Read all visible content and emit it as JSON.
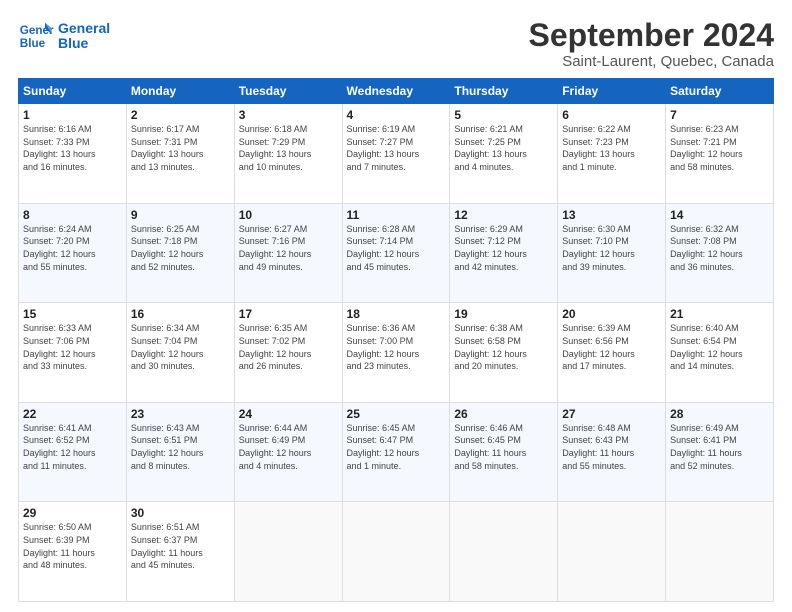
{
  "header": {
    "logo_line1": "General",
    "logo_line2": "Blue",
    "title": "September 2024",
    "subtitle": "Saint-Laurent, Quebec, Canada"
  },
  "calendar": {
    "days_of_week": [
      "Sunday",
      "Monday",
      "Tuesday",
      "Wednesday",
      "Thursday",
      "Friday",
      "Saturday"
    ],
    "weeks": [
      [
        {
          "day": "1",
          "info": "Sunrise: 6:16 AM\nSunset: 7:33 PM\nDaylight: 13 hours\nand 16 minutes."
        },
        {
          "day": "2",
          "info": "Sunrise: 6:17 AM\nSunset: 7:31 PM\nDaylight: 13 hours\nand 13 minutes."
        },
        {
          "day": "3",
          "info": "Sunrise: 6:18 AM\nSunset: 7:29 PM\nDaylight: 13 hours\nand 10 minutes."
        },
        {
          "day": "4",
          "info": "Sunrise: 6:19 AM\nSunset: 7:27 PM\nDaylight: 13 hours\nand 7 minutes."
        },
        {
          "day": "5",
          "info": "Sunrise: 6:21 AM\nSunset: 7:25 PM\nDaylight: 13 hours\nand 4 minutes."
        },
        {
          "day": "6",
          "info": "Sunrise: 6:22 AM\nSunset: 7:23 PM\nDaylight: 13 hours\nand 1 minute."
        },
        {
          "day": "7",
          "info": "Sunrise: 6:23 AM\nSunset: 7:21 PM\nDaylight: 12 hours\nand 58 minutes."
        }
      ],
      [
        {
          "day": "8",
          "info": "Sunrise: 6:24 AM\nSunset: 7:20 PM\nDaylight: 12 hours\nand 55 minutes."
        },
        {
          "day": "9",
          "info": "Sunrise: 6:25 AM\nSunset: 7:18 PM\nDaylight: 12 hours\nand 52 minutes."
        },
        {
          "day": "10",
          "info": "Sunrise: 6:27 AM\nSunset: 7:16 PM\nDaylight: 12 hours\nand 49 minutes."
        },
        {
          "day": "11",
          "info": "Sunrise: 6:28 AM\nSunset: 7:14 PM\nDaylight: 12 hours\nand 45 minutes."
        },
        {
          "day": "12",
          "info": "Sunrise: 6:29 AM\nSunset: 7:12 PM\nDaylight: 12 hours\nand 42 minutes."
        },
        {
          "day": "13",
          "info": "Sunrise: 6:30 AM\nSunset: 7:10 PM\nDaylight: 12 hours\nand 39 minutes."
        },
        {
          "day": "14",
          "info": "Sunrise: 6:32 AM\nSunset: 7:08 PM\nDaylight: 12 hours\nand 36 minutes."
        }
      ],
      [
        {
          "day": "15",
          "info": "Sunrise: 6:33 AM\nSunset: 7:06 PM\nDaylight: 12 hours\nand 33 minutes."
        },
        {
          "day": "16",
          "info": "Sunrise: 6:34 AM\nSunset: 7:04 PM\nDaylight: 12 hours\nand 30 minutes."
        },
        {
          "day": "17",
          "info": "Sunrise: 6:35 AM\nSunset: 7:02 PM\nDaylight: 12 hours\nand 26 minutes."
        },
        {
          "day": "18",
          "info": "Sunrise: 6:36 AM\nSunset: 7:00 PM\nDaylight: 12 hours\nand 23 minutes."
        },
        {
          "day": "19",
          "info": "Sunrise: 6:38 AM\nSunset: 6:58 PM\nDaylight: 12 hours\nand 20 minutes."
        },
        {
          "day": "20",
          "info": "Sunrise: 6:39 AM\nSunset: 6:56 PM\nDaylight: 12 hours\nand 17 minutes."
        },
        {
          "day": "21",
          "info": "Sunrise: 6:40 AM\nSunset: 6:54 PM\nDaylight: 12 hours\nand 14 minutes."
        }
      ],
      [
        {
          "day": "22",
          "info": "Sunrise: 6:41 AM\nSunset: 6:52 PM\nDaylight: 12 hours\nand 11 minutes."
        },
        {
          "day": "23",
          "info": "Sunrise: 6:43 AM\nSunset: 6:51 PM\nDaylight: 12 hours\nand 8 minutes."
        },
        {
          "day": "24",
          "info": "Sunrise: 6:44 AM\nSunset: 6:49 PM\nDaylight: 12 hours\nand 4 minutes."
        },
        {
          "day": "25",
          "info": "Sunrise: 6:45 AM\nSunset: 6:47 PM\nDaylight: 12 hours\nand 1 minute."
        },
        {
          "day": "26",
          "info": "Sunrise: 6:46 AM\nSunset: 6:45 PM\nDaylight: 11 hours\nand 58 minutes."
        },
        {
          "day": "27",
          "info": "Sunrise: 6:48 AM\nSunset: 6:43 PM\nDaylight: 11 hours\nand 55 minutes."
        },
        {
          "day": "28",
          "info": "Sunrise: 6:49 AM\nSunset: 6:41 PM\nDaylight: 11 hours\nand 52 minutes."
        }
      ],
      [
        {
          "day": "29",
          "info": "Sunrise: 6:50 AM\nSunset: 6:39 PM\nDaylight: 11 hours\nand 48 minutes."
        },
        {
          "day": "30",
          "info": "Sunrise: 6:51 AM\nSunset: 6:37 PM\nDaylight: 11 hours\nand 45 minutes."
        },
        {
          "day": "",
          "info": ""
        },
        {
          "day": "",
          "info": ""
        },
        {
          "day": "",
          "info": ""
        },
        {
          "day": "",
          "info": ""
        },
        {
          "day": "",
          "info": ""
        }
      ]
    ]
  }
}
